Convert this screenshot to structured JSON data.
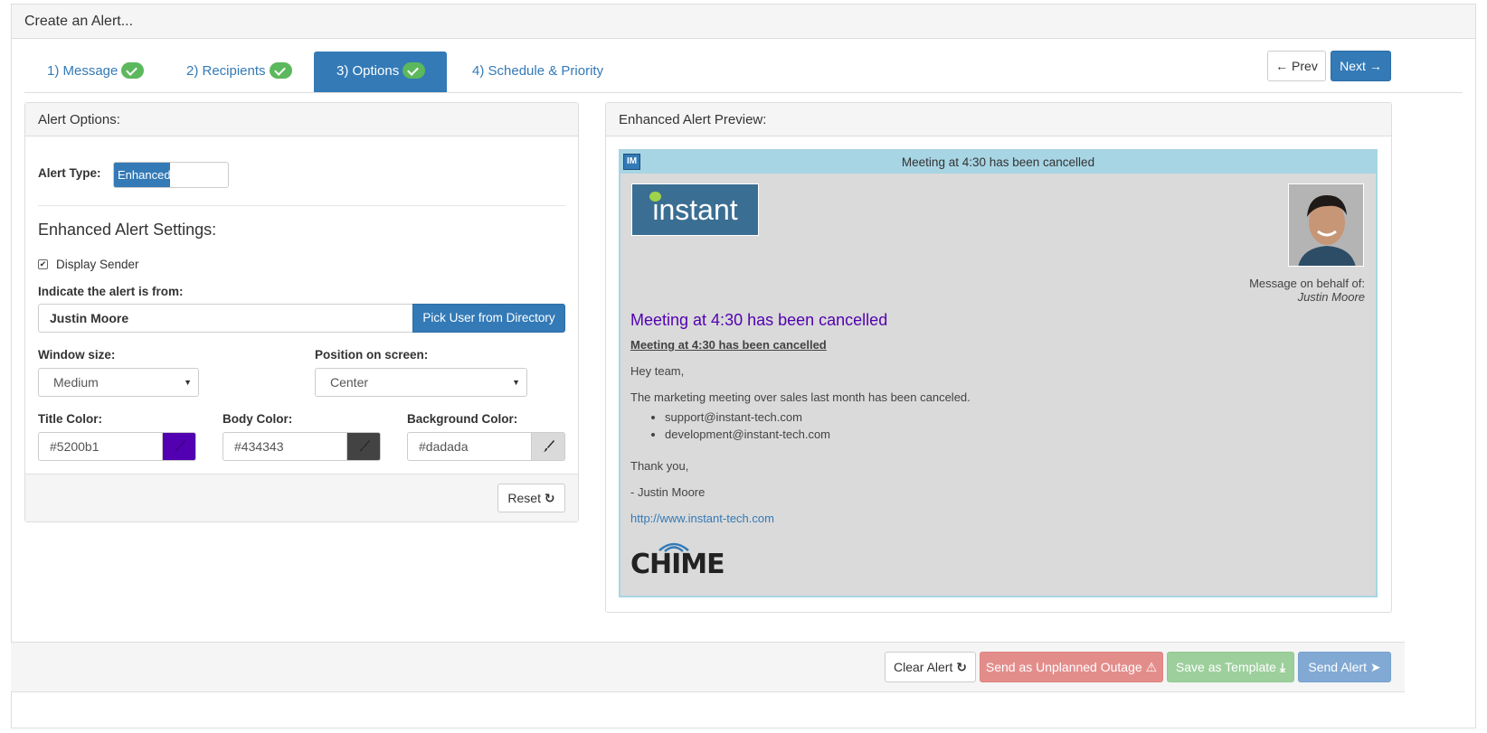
{
  "header": {
    "title": "Create an Alert..."
  },
  "tabs": [
    {
      "label": "1) Message",
      "done": true
    },
    {
      "label": "2) Recipients",
      "done": true
    },
    {
      "label": "3) Options",
      "done": true,
      "active": true
    },
    {
      "label": "4) Schedule & Priority",
      "done": false
    }
  ],
  "nav": {
    "prev_label": "Prev",
    "next_label": "Next"
  },
  "options_panel": {
    "title": "Alert Options:",
    "alert_type_label": "Alert Type:",
    "alert_type_value": "Enhanced",
    "settings_heading": "Enhanced Alert Settings:",
    "display_sender_label": "Display Sender",
    "display_sender_checked": true,
    "from_label": "Indicate the alert is from:",
    "from_value": "Justin Moore",
    "pick_user_label": "Pick User from Directory",
    "window_size_label": "Window size:",
    "window_size_value": "Medium",
    "position_label": "Position on screen:",
    "position_value": "Center",
    "title_color_label": "Title Color:",
    "title_color": "#5200b1",
    "body_color_label": "Body Color:",
    "body_color": "#434343",
    "background_color_label": "Background Color:",
    "background_color": "#dadada",
    "reset_label": "Reset"
  },
  "preview_panel": {
    "title": "Enhanced Alert Preview:",
    "bar_title": "Meeting at 4:30 has been cancelled",
    "logo_text": "instant",
    "behalf_label": "Message on behalf of:",
    "behalf_name": "Justin Moore",
    "heading": "Meeting at 4:30 has been cancelled",
    "subheading": "Meeting at 4:30 has been cancelled",
    "greeting": "Hey team,",
    "body": "The marketing meeting over sales last month has been canceled.",
    "list": [
      "support@instant-tech.com",
      "development@instant-tech.com"
    ],
    "closing": "Thank you,",
    "signature": "- Justin Moore",
    "link": "http://www.instant-tech.com",
    "brand": "CHIME"
  },
  "footer": {
    "clear_label": "Clear Alert",
    "outage_label": "Send as Unplanned Outage",
    "template_label": "Save as Template",
    "send_label": "Send Alert"
  },
  "colors": {
    "primary": "#337ab7",
    "success": "#5cb85c",
    "danger_light": "#e38d8b",
    "success_light": "#9ccf9c",
    "primary_light": "#81a9d3",
    "preview_border": "#a7d5e4"
  }
}
